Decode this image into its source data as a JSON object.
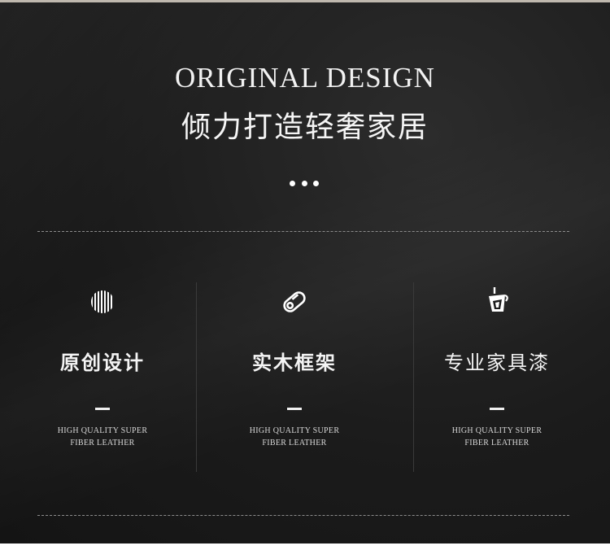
{
  "header": {
    "title_en": "ORIGINAL DESIGN",
    "title_cn": "倾力打造轻奢家居"
  },
  "features": [
    {
      "icon": "striped-circle-icon",
      "title": "原创设计",
      "sub_line1": "HIGH QUALITY SUPER",
      "sub_line2": "FIBER LEATHER"
    },
    {
      "icon": "wood-log-icon",
      "title": "实木框架",
      "sub_line1": "HIGH QUALITY SUPER",
      "sub_line2": "FIBER LEATHER"
    },
    {
      "icon": "paint-bucket-icon",
      "title": "专业家具漆",
      "sub_line1": "HIGH QUALITY SUPER",
      "sub_line2": "FIBER LEATHER"
    }
  ],
  "colors": {
    "background": "#1b1b1b",
    "text": "#f4f4f4",
    "divider": "#8c8c8c"
  }
}
